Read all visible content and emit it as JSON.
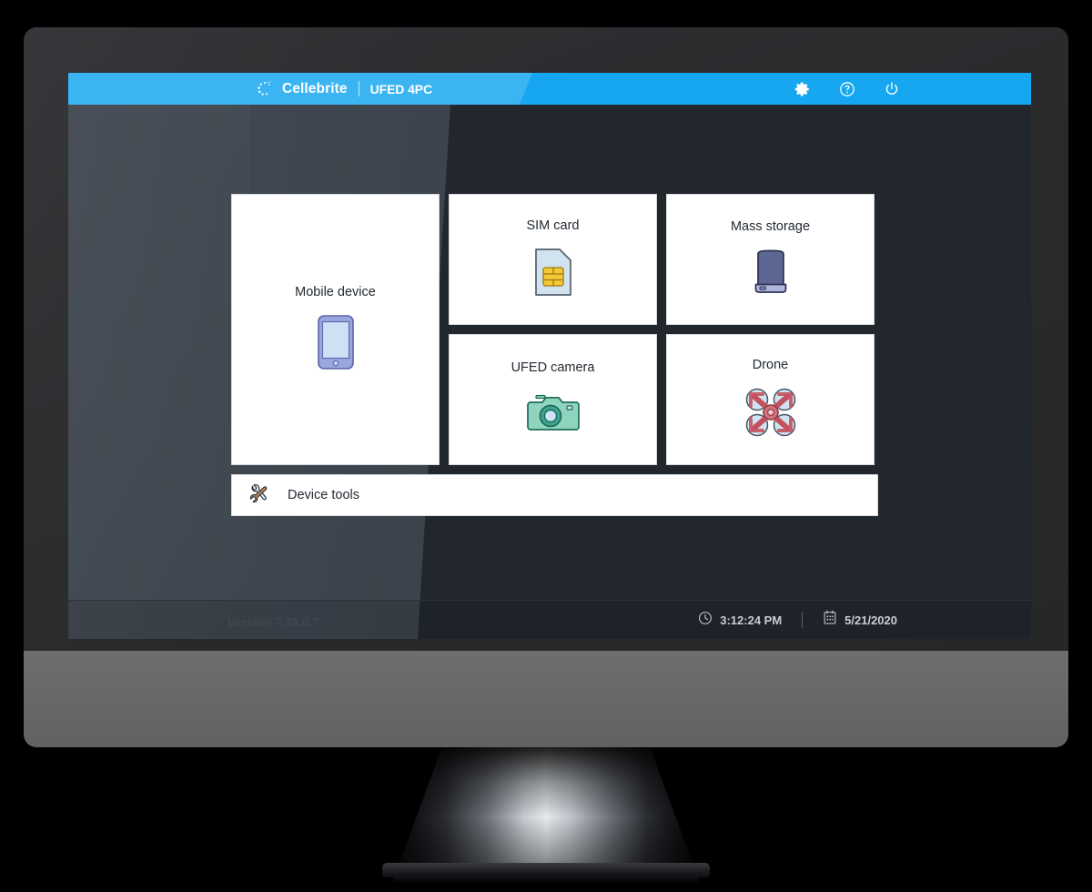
{
  "colors": {
    "header_blue": "#16a7f0",
    "header_blue_light": "#3bb4f2",
    "screen_dark": "#22272e",
    "screen_glare": "#434a53",
    "tile_white": "#ffffff",
    "tile_border": "#d7dade",
    "bezel": "#2a2b2d",
    "chin_gray": "#6a6a6b",
    "text_dark": "#232a31",
    "status_text": "#c9ced5"
  },
  "header": {
    "logo_icon": "cellebrite-dots-logo-icon",
    "brand_name": "Cellebrite",
    "product_name": "UFED 4PC",
    "actions": [
      {
        "name": "settings",
        "icon": "gear-icon",
        "label": "Settings"
      },
      {
        "name": "help",
        "icon": "question-circle-icon",
        "label": "Help"
      },
      {
        "name": "power",
        "icon": "power-icon",
        "label": "Power"
      }
    ]
  },
  "main": {
    "tiles": [
      {
        "id": "mobile-device",
        "label": "Mobile device",
        "icon": "smartphone-icon"
      },
      {
        "id": "sim-card",
        "label": "SIM card",
        "icon": "sim-card-icon"
      },
      {
        "id": "mass-storage",
        "label": "Mass storage",
        "icon": "external-hard-drive-icon"
      },
      {
        "id": "ufed-camera",
        "label": "UFED camera",
        "icon": "camera-icon"
      },
      {
        "id": "drone",
        "label": "Drone",
        "icon": "quadcopter-drone-icon"
      }
    ],
    "device_tools": {
      "label": "Device tools",
      "icon": "hammer-wrench-icon"
    }
  },
  "status_bar": {
    "clock_icon": "clock-icon",
    "time": "3:12:24 PM",
    "calendar_icon": "calendar-icon",
    "date": "5/21/2020",
    "version": "Version 7.33.0.7"
  }
}
